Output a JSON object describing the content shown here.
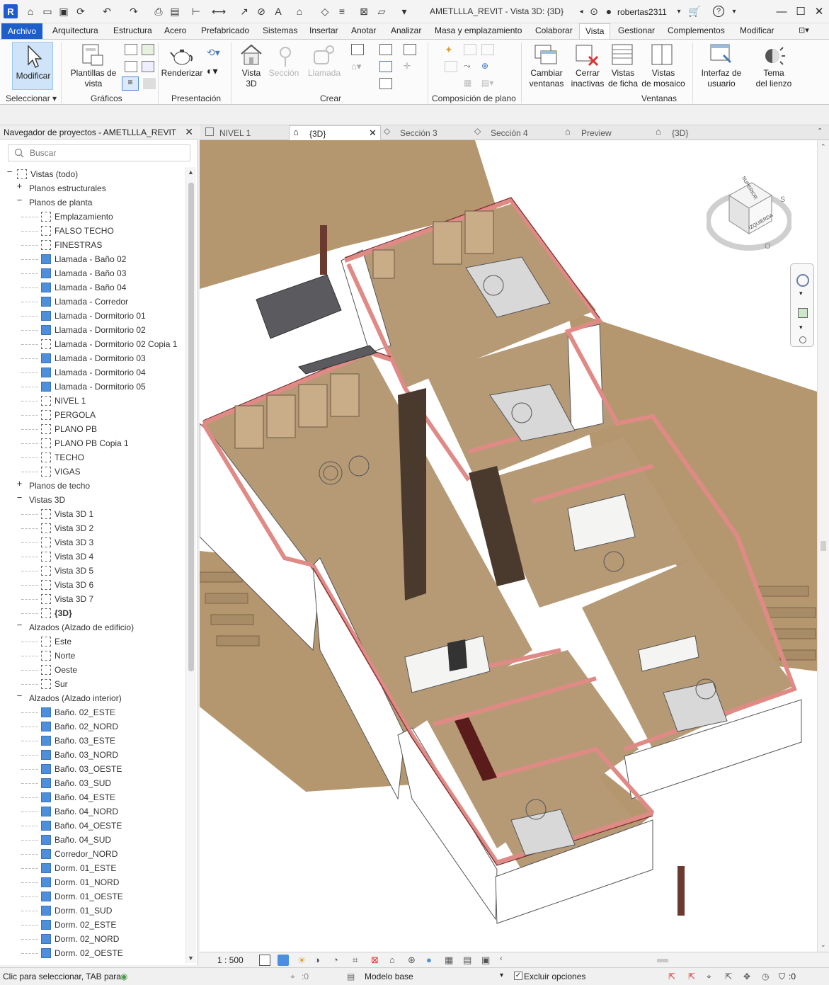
{
  "window": {
    "title": "AMETLLLA_REVIT - Vista 3D: {3D}",
    "user": "robertas2311",
    "app_logo": "R"
  },
  "ribbon_tabs": [
    "Archivo",
    "Arquitectura",
    "Estructura",
    "Acero",
    "Prefabricado",
    "Sistemas",
    "Insertar",
    "Anotar",
    "Analizar",
    "Masa y emplazamiento",
    "Colaborar",
    "Vista",
    "Gestionar",
    "Complementos",
    "Modificar"
  ],
  "ribbon": {
    "modificar": "Modificar",
    "seleccionar": "Seleccionar",
    "plantillas": [
      "Plantillas de",
      "vista"
    ],
    "graficos": "Gráficos",
    "renderizar": "Renderizar",
    "presentacion": "Presentación",
    "vista3d": [
      "Vista",
      "3D"
    ],
    "seccion": "Sección",
    "llamada": "Llamada",
    "crear": "Crear",
    "composicion": "Composición de plano",
    "cambiar": [
      "Cambiar",
      "ventanas"
    ],
    "cerrar": [
      "Cerrar",
      "inactivas"
    ],
    "ficha": [
      "Vistas",
      "de ficha"
    ],
    "mosaico": [
      "Vistas",
      "de mosaico"
    ],
    "ventanas": "Ventanas",
    "interfaz": [
      "Interfaz de",
      "usuario"
    ],
    "tema": [
      "Tema",
      "del lienzo"
    ]
  },
  "browser": {
    "title": "Navegador de proyectos - AMETLLLA_REVIT",
    "search_placeholder": "Buscar",
    "tree": [
      {
        "label": "Vistas (todo)",
        "level": 0,
        "exp": "−",
        "icon": "views"
      },
      {
        "label": "Planos estructurales",
        "level": 1,
        "exp": "+"
      },
      {
        "label": "Planos de planta",
        "level": 1,
        "exp": "−"
      },
      {
        "label": "Emplazamiento",
        "level": 2,
        "icon": "plain"
      },
      {
        "label": "FALSO TECHO",
        "level": 2,
        "icon": "plain"
      },
      {
        "label": "FINESTRAS",
        "level": 2,
        "icon": "plain"
      },
      {
        "label": "Llamada - Baño 02",
        "level": 2,
        "icon": "blue"
      },
      {
        "label": "Llamada - Baño 03",
        "level": 2,
        "icon": "blue"
      },
      {
        "label": "Llamada - Baño 04",
        "level": 2,
        "icon": "blue"
      },
      {
        "label": "Llamada - Corredor",
        "level": 2,
        "icon": "blue"
      },
      {
        "label": "Llamada - Dormitorio 01",
        "level": 2,
        "icon": "blue"
      },
      {
        "label": "Llamada - Dormitorio 02",
        "level": 2,
        "icon": "blue"
      },
      {
        "label": "Llamada - Dormitorio 02 Copia 1",
        "level": 2,
        "icon": "plain"
      },
      {
        "label": "Llamada - Dormitorio 03",
        "level": 2,
        "icon": "blue"
      },
      {
        "label": "Llamada - Dormitorio 04",
        "level": 2,
        "icon": "blue"
      },
      {
        "label": "Llamada - Dormitorio 05",
        "level": 2,
        "icon": "blue"
      },
      {
        "label": "NIVEL 1",
        "level": 2,
        "icon": "plain"
      },
      {
        "label": "PERGOLA",
        "level": 2,
        "icon": "plain"
      },
      {
        "label": "PLANO PB",
        "level": 2,
        "icon": "plain"
      },
      {
        "label": "PLANO PB Copia 1",
        "level": 2,
        "icon": "plain"
      },
      {
        "label": "TECHO",
        "level": 2,
        "icon": "plain"
      },
      {
        "label": "VIGAS",
        "level": 2,
        "icon": "plain"
      },
      {
        "label": "Planos de techo",
        "level": 1,
        "exp": "+"
      },
      {
        "label": "Vistas 3D",
        "level": 1,
        "exp": "−"
      },
      {
        "label": "Vista 3D 1",
        "level": 2,
        "icon": "plain"
      },
      {
        "label": "Vista 3D 2",
        "level": 2,
        "icon": "plain"
      },
      {
        "label": "Vista 3D 3",
        "level": 2,
        "icon": "plain"
      },
      {
        "label": "Vista 3D 4",
        "level": 2,
        "icon": "plain"
      },
      {
        "label": "Vista 3D 5",
        "level": 2,
        "icon": "plain"
      },
      {
        "label": "Vista 3D 6",
        "level": 2,
        "icon": "plain"
      },
      {
        "label": "Vista 3D 7",
        "level": 2,
        "icon": "plain"
      },
      {
        "label": "{3D}",
        "level": 2,
        "icon": "plain",
        "bold": true
      },
      {
        "label": "Alzados (Alzado de edificio)",
        "level": 1,
        "exp": "−"
      },
      {
        "label": "Este",
        "level": 2,
        "icon": "plain"
      },
      {
        "label": "Norte",
        "level": 2,
        "icon": "plain"
      },
      {
        "label": "Oeste",
        "level": 2,
        "icon": "plain"
      },
      {
        "label": "Sur",
        "level": 2,
        "icon": "plain"
      },
      {
        "label": "Alzados (Alzado interior)",
        "level": 1,
        "exp": "−"
      },
      {
        "label": "Baño. 02_ESTE",
        "level": 2,
        "icon": "blue"
      },
      {
        "label": "Baño. 02_NORD",
        "level": 2,
        "icon": "blue"
      },
      {
        "label": "Baño. 03_ESTE",
        "level": 2,
        "icon": "blue"
      },
      {
        "label": "Baño. 03_NORD",
        "level": 2,
        "icon": "blue"
      },
      {
        "label": "Baño. 03_OESTE",
        "level": 2,
        "icon": "blue"
      },
      {
        "label": "Baño. 03_SUD",
        "level": 2,
        "icon": "blue"
      },
      {
        "label": "Baño. 04_ESTE",
        "level": 2,
        "icon": "blue"
      },
      {
        "label": "Baño. 04_NORD",
        "level": 2,
        "icon": "blue"
      },
      {
        "label": "Baño. 04_OESTE",
        "level": 2,
        "icon": "blue"
      },
      {
        "label": "Baño. 04_SUD",
        "level": 2,
        "icon": "blue"
      },
      {
        "label": "Corredor_NORD",
        "level": 2,
        "icon": "blue"
      },
      {
        "label": "Dorm. 01_ESTE",
        "level": 2,
        "icon": "blue"
      },
      {
        "label": "Dorm. 01_NORD",
        "level": 2,
        "icon": "blue"
      },
      {
        "label": "Dorm. 01_OESTE",
        "level": 2,
        "icon": "blue"
      },
      {
        "label": "Dorm. 01_SUD",
        "level": 2,
        "icon": "blue"
      },
      {
        "label": "Dorm. 02_ESTE",
        "level": 2,
        "icon": "blue"
      },
      {
        "label": "Dorm. 02_NORD",
        "level": 2,
        "icon": "blue"
      },
      {
        "label": "Dorm. 02_OESTE",
        "level": 2,
        "icon": "blue"
      }
    ]
  },
  "view_tabs": [
    {
      "label": "NIVEL 1",
      "icon": "plan-icon",
      "active": false
    },
    {
      "label": "{3D}",
      "icon": "house-icon",
      "active": true
    },
    {
      "label": "Sección 3",
      "icon": "section-icon",
      "active": false
    },
    {
      "label": "Sección 4",
      "icon": "section-icon",
      "active": false
    },
    {
      "label": "Preview",
      "icon": "house-icon",
      "active": false
    },
    {
      "label": "{3D}",
      "icon": "house-icon",
      "active": false
    }
  ],
  "viewcube": {
    "faces": [
      "SUPERIOR",
      "IZQUIERDA"
    ],
    "compass": [
      "S",
      "O"
    ]
  },
  "viewbar": {
    "scale": "1 : 500"
  },
  "status": {
    "hint": "Clic para seleccionar, TAB para",
    "count1": ":0",
    "model": "Modelo base",
    "exclude": "Excluir opciones",
    "filter": ":0"
  },
  "colors": {
    "file_tab": "#1e5ec9",
    "floor": "#b69a76",
    "cut_wall": "#e08a86",
    "wall": "#ffffff",
    "roof": "#b5976f"
  }
}
